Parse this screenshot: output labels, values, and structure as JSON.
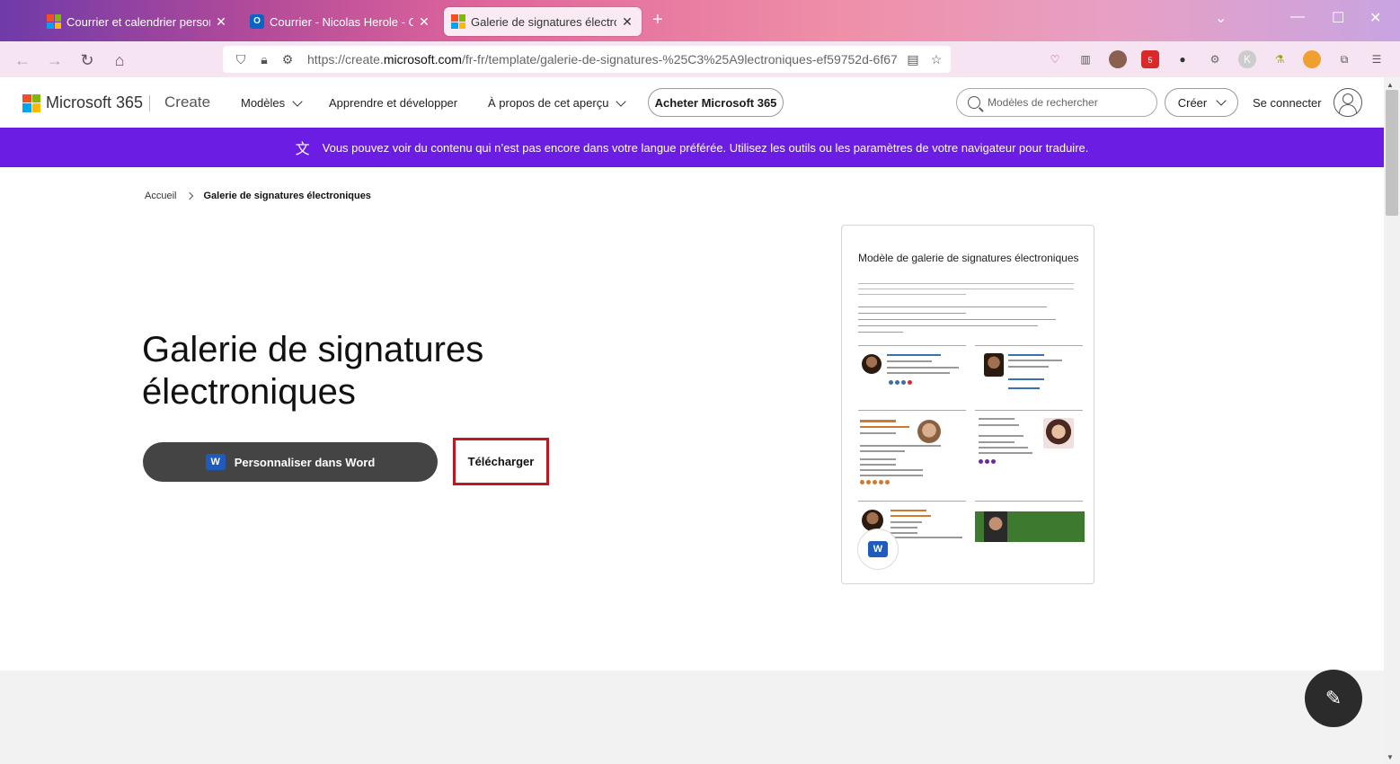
{
  "browser": {
    "tabs": [
      {
        "label": "Courrier et calendrier personnel",
        "close": "✕"
      },
      {
        "label": "Courrier - Nicolas Herole - Outlook",
        "close": "✕"
      },
      {
        "label": "Galerie de signatures électroniques",
        "close": "✕"
      }
    ],
    "new_tab": "+",
    "url_prefix": "https://create.",
    "url_domain": "microsoft.com",
    "url_rest": "/fr-fr/template/galerie-de-signatures-%25C3%25A9lectroniques-ef59752d-6f67",
    "extension_badge": "5"
  },
  "header": {
    "brand": "Microsoft 365",
    "create": "Create",
    "menu": {
      "models": "Modèles",
      "learn": "Apprendre et développer",
      "about": "À propos de cet aperçu"
    },
    "buy": "Acheter Microsoft 365",
    "search_placeholder": "Modèles de rechercher",
    "create_btn": "Créer",
    "sign_in": "Se connecter"
  },
  "banner": {
    "text": "Vous pouvez voir du contenu qui n’est pas encore dans votre langue préférée. Utilisez les outils ou les paramètres de votre navigateur pour traduire."
  },
  "breadcrumb": {
    "home": "Accueil",
    "current": "Galerie de signatures électroniques"
  },
  "main": {
    "title": "Galerie de signatures électroniques",
    "customize": "Personnaliser dans Word",
    "download": "Télécharger"
  },
  "preview": {
    "title": "Modèle de galerie de signatures électroniques"
  },
  "colors": {
    "banner": "#6b1de4",
    "primary_button": "#444444",
    "highlight": "#c0161f"
  }
}
